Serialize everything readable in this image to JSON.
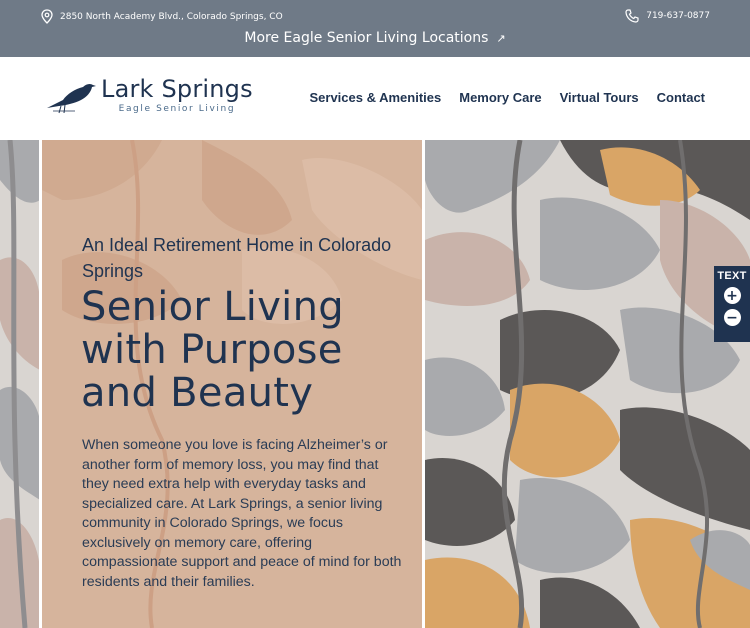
{
  "topbar": {
    "address": "2850 North Academy Blvd., Colorado Springs, CO",
    "phone": "719-637-0877",
    "more_locations": "More Eagle Senior Living Locations",
    "more_arrow": "↗"
  },
  "header": {
    "logo_name": "Lark Springs",
    "logo_sub": "Eagle Senior Living",
    "nav": [
      "Services & Amenities",
      "Memory Care",
      "Virtual Tours",
      "Contact"
    ]
  },
  "hero": {
    "eyebrow": "An Ideal Retirement Home in Colorado Springs",
    "headline": "Senior Living with Purpose and Beauty",
    "body": "When someone you love is facing Alzheimer’s or another form of memory loss, you may find that they need extra help with everyday tasks and specialized care. At Lark Springs, a senior living community in Colorado Springs, we focus exclusively on memory care, offering compassionate support and peace of mind for both residents and their families."
  },
  "text_size_widget": {
    "label": "TEXT",
    "increase": "+",
    "decrease": "−"
  },
  "colors": {
    "topbar_bg": "#6f7a87",
    "navy": "#1f3350",
    "panel": "#d6b49c",
    "pattern_orange": "#d9a566",
    "pattern_dark": "#5b5857",
    "pattern_grey": "#a9aaad",
    "pattern_pink": "#c9b3aa"
  },
  "icons": [
    "location-pin-icon",
    "phone-icon",
    "external-link-icon",
    "bird-logo-icon",
    "plus-icon",
    "minus-icon"
  ]
}
